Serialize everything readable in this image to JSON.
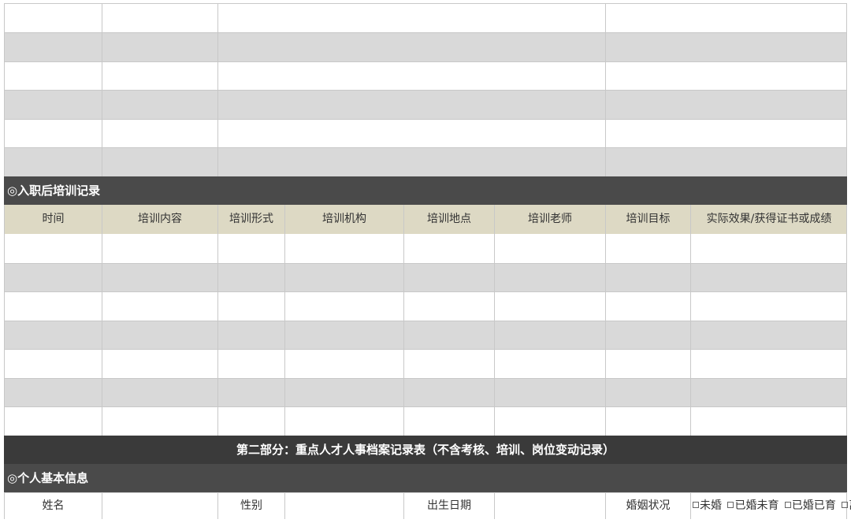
{
  "section_training": {
    "title": "◎入职后培训记录",
    "headers": [
      "时间",
      "培训内容",
      "培训形式",
      "培训机构",
      "培训地点",
      "培训老师",
      "培训目标",
      "实际效果/获得证书或成绩"
    ]
  },
  "part_two": {
    "title": "第二部分：重点人才人事档案记录表（不含考核、培训、岗位变动记录）"
  },
  "section_basic": {
    "title": "◎个人基本信息",
    "name_label": "姓名",
    "gender_label": "性别",
    "birth_label": "出生日期",
    "marital_label": "婚姻状况",
    "marital_options": [
      "未婚",
      "已婚未育",
      "已婚已育",
      "离婚"
    ]
  },
  "colors": {
    "dark_header": "#4a4a4a",
    "column_header": "#ddd9c4",
    "stripe": "#d9d9d9"
  }
}
